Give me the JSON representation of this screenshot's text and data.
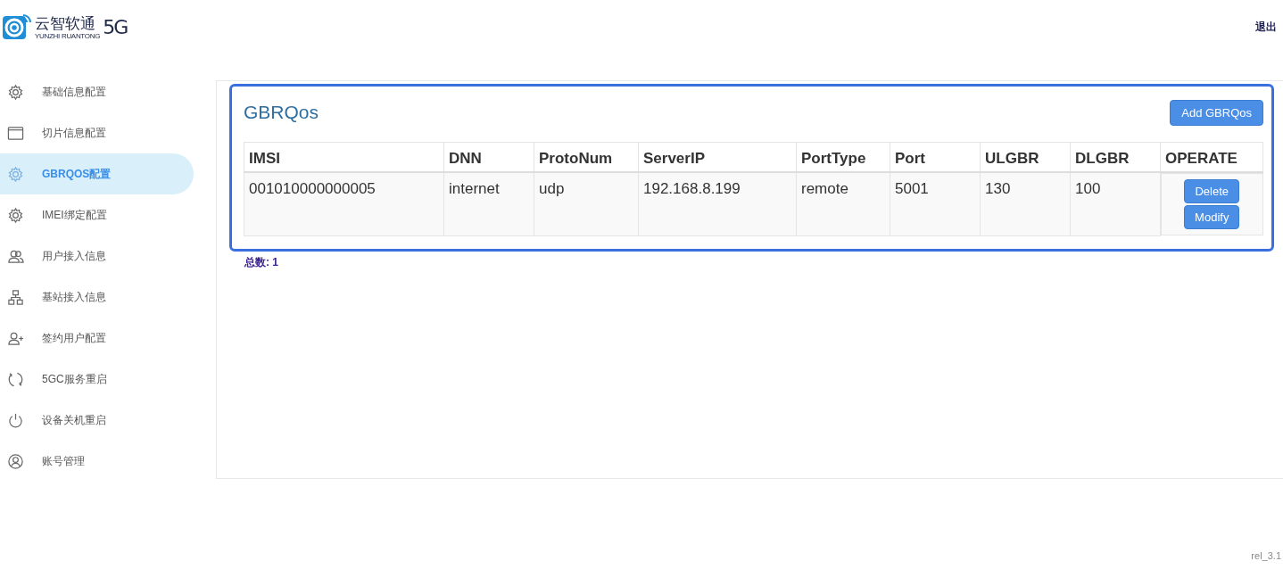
{
  "header": {
    "logo": {
      "name": "云智软通",
      "subtitle": "YUNZHI RUANTONG",
      "badge": "5G"
    },
    "logout": "退出"
  },
  "sidebar": {
    "items": [
      {
        "label": "基础信息配置",
        "selected": false
      },
      {
        "label": "切片信息配置",
        "selected": false
      },
      {
        "label": "GBRQOS配置",
        "selected": true
      },
      {
        "label": "IMEI绑定配置",
        "selected": false
      },
      {
        "label": "用户接入信息",
        "selected": false
      },
      {
        "label": "基站接入信息",
        "selected": false
      },
      {
        "label": "签约用户配置",
        "selected": false
      },
      {
        "label": "5GC服务重启",
        "selected": false
      },
      {
        "label": "设备关机重启",
        "selected": false
      },
      {
        "label": "账号管理",
        "selected": false
      }
    ]
  },
  "panel": {
    "title": "GBRQos",
    "add_button": "Add GBRQos",
    "table": {
      "columns": [
        "IMSI",
        "DNN",
        "ProtoNum",
        "ServerIP",
        "PortType",
        "Port",
        "ULGBR",
        "DLGBR",
        "OPERATE"
      ],
      "rows": [
        {
          "cells": [
            "001010000000005",
            "internet",
            "udp",
            "192.168.8.199",
            "remote",
            "5001",
            "130",
            "100"
          ],
          "actions": [
            "Delete",
            "Modify"
          ]
        }
      ]
    },
    "total": "总数: 1"
  },
  "version": "rel_3.1"
}
